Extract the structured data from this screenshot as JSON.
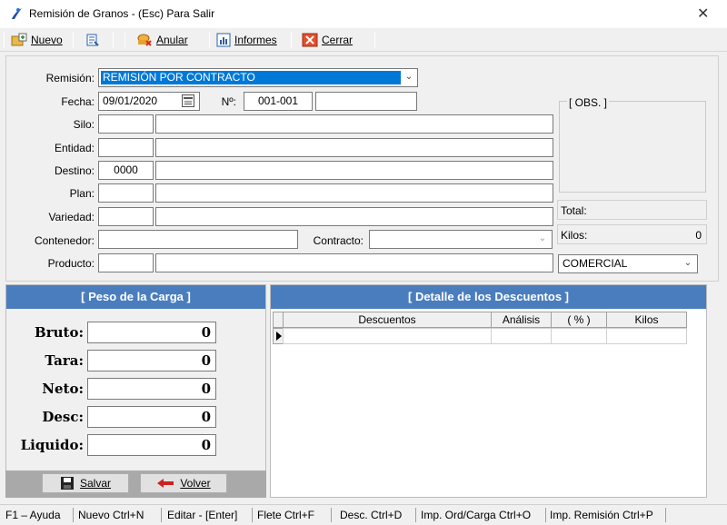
{
  "window": {
    "title": "Remisión de Granos  -  (Esc) Para Salir",
    "close": "✕"
  },
  "toolbar": {
    "nuevo": "Nuevo",
    "anular": "Anular",
    "informes": "Informes",
    "cerrar": "Cerrar"
  },
  "form": {
    "remision_label": "Remisión:",
    "remision_value": "REMISIÓN POR CONTRACTO",
    "fecha_label": "Fecha:",
    "fecha_value": "09/01/2020",
    "numero_label": "Nº:",
    "numero_value": "001-001",
    "numero_extra": "",
    "silo_label": "Silo:",
    "entidad_label": "Entidad:",
    "destino_label": "Destino:",
    "destino_code": "0000",
    "plan_label": "Plan:",
    "variedad_label": "Variedad:",
    "contenedor_label": "Contenedor:",
    "contracto_label": "Contracto:",
    "producto_label": "Producto:"
  },
  "obs": {
    "label": "[ OBS. ]"
  },
  "totals": {
    "total_label": "Total:",
    "kilos_label": "Kilos:",
    "kilos_value": "0",
    "tipo_value": "COMERCIAL"
  },
  "peso": {
    "header": "[ Peso de la Carga ]",
    "rows": [
      {
        "label": "Bruto:",
        "value": "0"
      },
      {
        "label": "Tara:",
        "value": "0"
      },
      {
        "label": "Neto:",
        "value": "0"
      },
      {
        "label": "Desc:",
        "value": "0"
      },
      {
        "label": "Liquido:",
        "value": "0"
      }
    ],
    "salvar": "Salvar",
    "volver": "Volver"
  },
  "descuentos": {
    "header": "[ Detalle de los Descuentos ]",
    "columns": [
      "Descuentos",
      "Análisis",
      "( % )",
      "Kilos"
    ]
  },
  "status": [
    "F1 – Ayuda",
    "Nuevo Ctrl+N",
    "Editar - [Enter]",
    "Flete Ctrl+F",
    "Desc. Ctrl+D",
    "Imp. Ord/Carga Ctrl+O",
    "Imp. Remisión Ctrl+P"
  ],
  "colors": {
    "header_blue": "#4a7dbe",
    "selection_blue": "#0078d7"
  }
}
